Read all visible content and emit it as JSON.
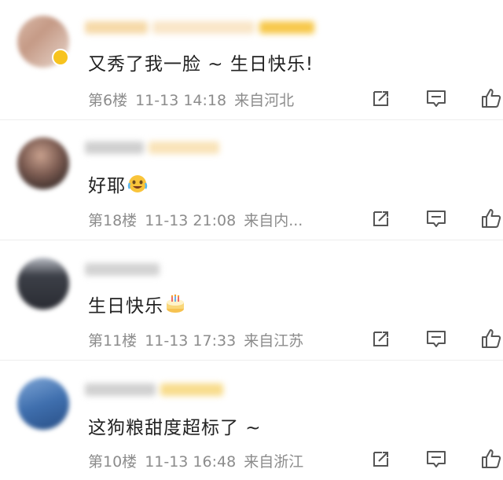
{
  "comments": [
    {
      "text": "又秀了我一脸 ~ 生日快乐!",
      "floor": "第6楼",
      "time": "11-13 14:18",
      "location": "来自河北"
    },
    {
      "text": "好耶",
      "emoji": "crying-laughing-emoji",
      "floor": "第18楼",
      "time": "11-13 21:08",
      "location": "来自内..."
    },
    {
      "text": "生日快乐",
      "emoji": "birthday-cake-emoji",
      "floor": "第11楼",
      "time": "11-13 17:33",
      "location": "来自江苏"
    },
    {
      "text": "这狗粮甜度超标了 ~",
      "floor": "第10楼",
      "time": "11-13 16:48",
      "location": "来自浙江"
    }
  ],
  "icons": {
    "share": "share-icon",
    "reply": "comment-icon",
    "like": "thumbs-up-icon"
  },
  "colors": {
    "text": "#222222",
    "meta": "#8c8c8c",
    "icon": "#555555",
    "vip": "#f7c31e"
  }
}
